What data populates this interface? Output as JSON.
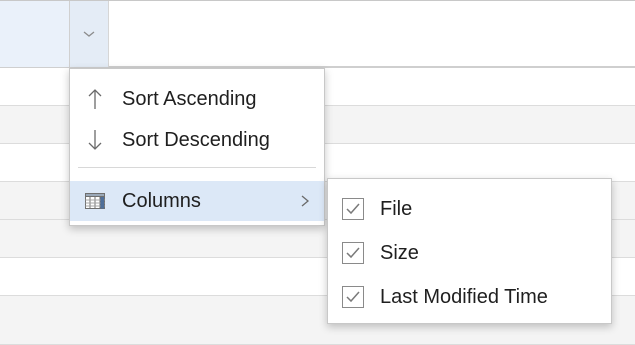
{
  "context_menu": {
    "items": [
      {
        "label": "Sort Ascending",
        "icon": "arrow-up-icon"
      },
      {
        "label": "Sort Descending",
        "icon": "arrow-down-icon"
      },
      {
        "label": "Columns",
        "icon": "columns-icon",
        "has_submenu": true
      }
    ]
  },
  "columns_submenu": {
    "items": [
      {
        "label": "File",
        "checked": true
      },
      {
        "label": "Size",
        "checked": true
      },
      {
        "label": "Last Modified Time",
        "checked": true
      }
    ]
  },
  "colors": {
    "highlight": "#dce8f7",
    "header_active": "#eaf1fa"
  }
}
